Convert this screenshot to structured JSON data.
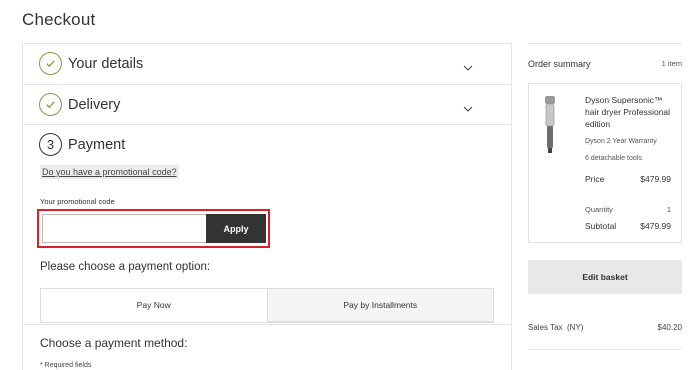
{
  "page": {
    "title": "Checkout"
  },
  "steps": {
    "details": {
      "title": "Your details",
      "status": "complete"
    },
    "delivery": {
      "title": "Delivery",
      "status": "complete"
    },
    "payment": {
      "number": "3",
      "title": "Payment",
      "status": "active"
    }
  },
  "promo": {
    "link_label": "Do you have a promotional code?",
    "field_label": "Your promotional code",
    "value": "",
    "placeholder": "",
    "apply_label": "Apply"
  },
  "payment_option": {
    "heading": "Please choose a payment option:",
    "tabs": [
      {
        "label": "Pay Now",
        "active": true
      },
      {
        "label": "Pay by Installments",
        "active": false
      }
    ]
  },
  "payment_method": {
    "heading": "Choose a payment method:",
    "required_note": "* Required fields"
  },
  "summary": {
    "title": "Order summary",
    "count": "1 item",
    "product": {
      "name": "Dyson Supersonic™ hair dryer Professional edition",
      "warranty": "Dyson 2 Year Warranty",
      "feature": "6 detachable tools",
      "price_label": "Price",
      "price": "$479.99",
      "quantity_label": "Quantity",
      "quantity": "1",
      "subtotal_label": "Subtotal",
      "subtotal": "$479.99"
    },
    "edit_label": "Edit basket",
    "tax_label": "Sales Tax  (NY)",
    "tax_value": "$40.20"
  },
  "colors": {
    "check_green": "#7aa03b",
    "highlight_red": "#d9202d",
    "button_dark": "#333333"
  }
}
